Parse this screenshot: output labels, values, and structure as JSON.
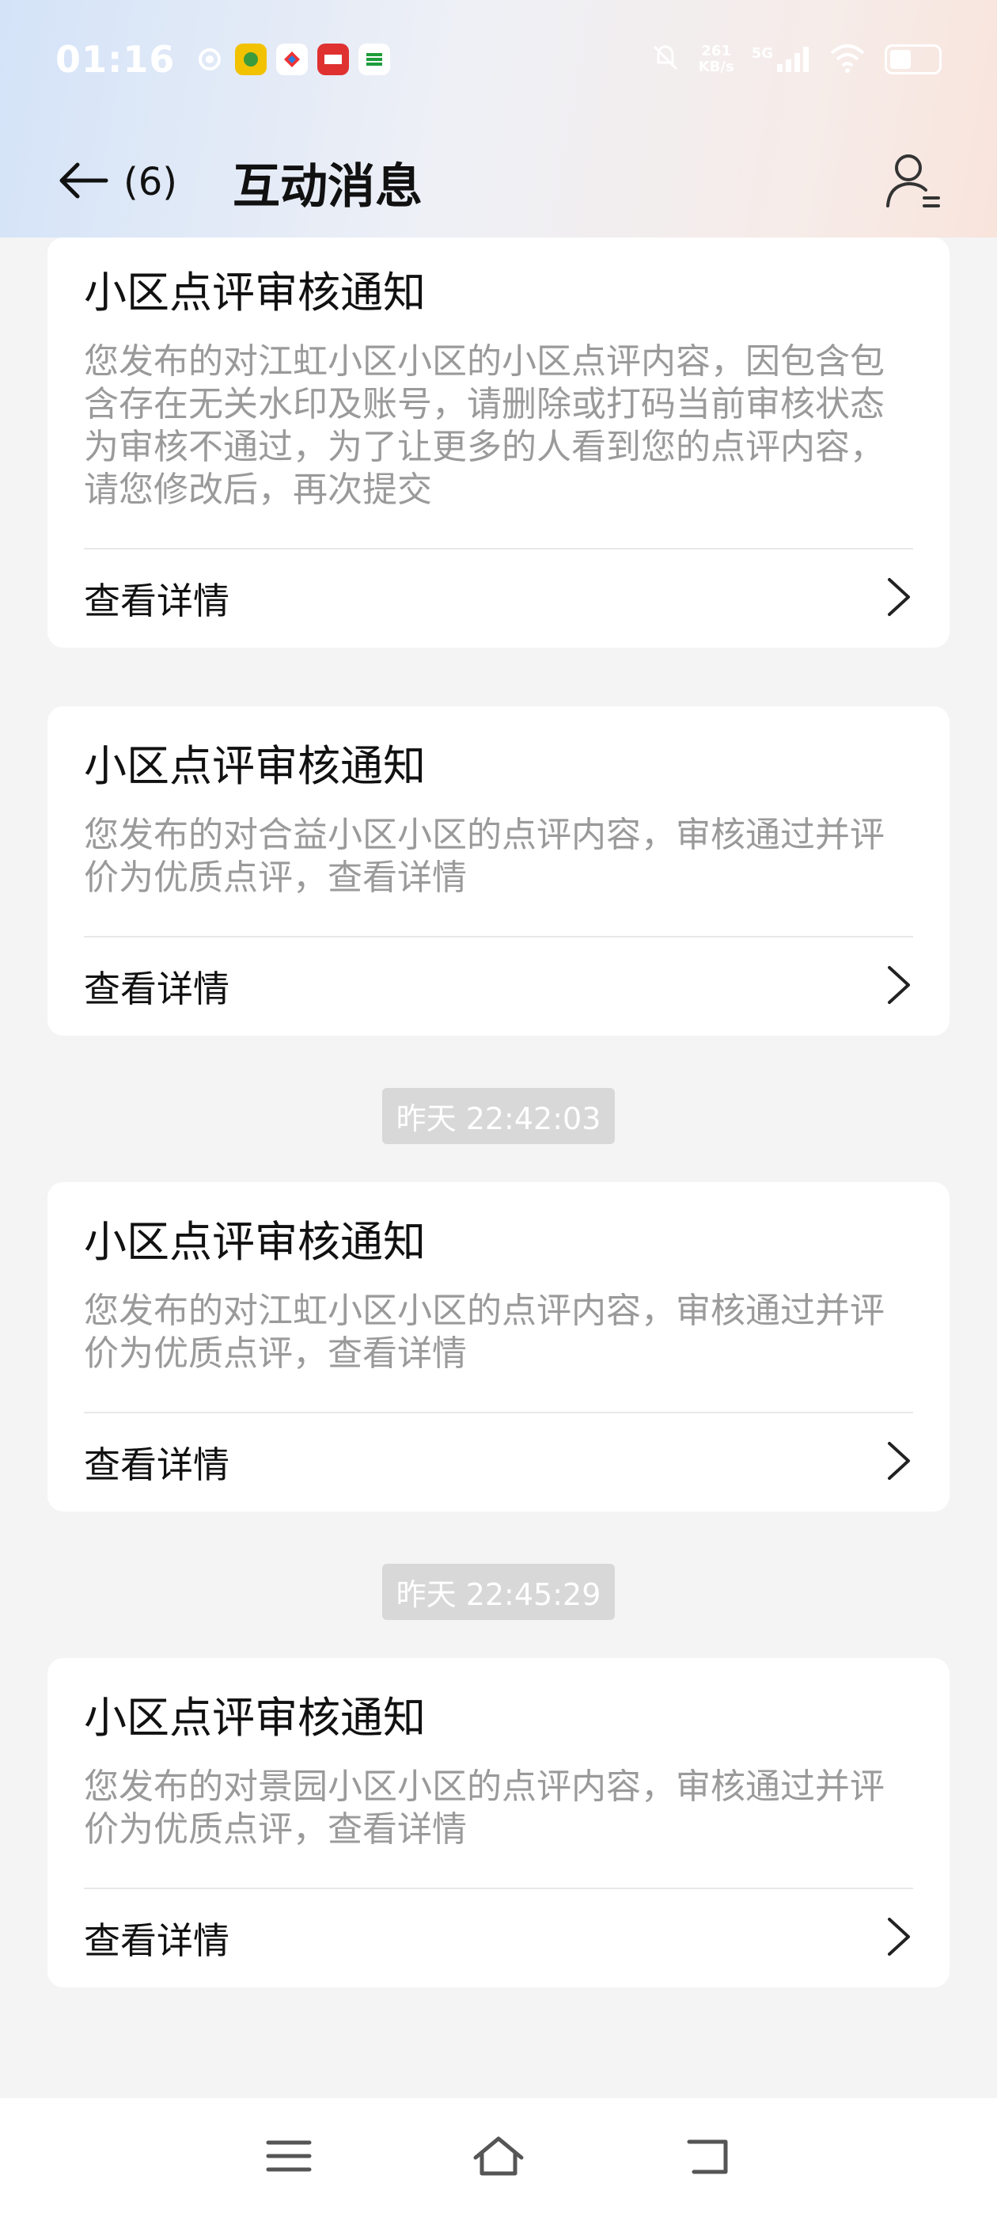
{
  "status_bar": {
    "time": "01:16",
    "net_speed_value": "261",
    "net_speed_unit": "KB/s",
    "signal_label": "5G"
  },
  "header": {
    "back_count": "(6)",
    "title": "互动消息"
  },
  "cards": [
    {
      "title": "小区点评审核通知",
      "body": "您发布的对江虹小区小区的小区点评内容，因包含包含存在无关水印及账号，请删除或打码当前审核状态为审核不通过，为了让更多的人看到您的点评内容，请您修改后，再次提交",
      "link_label": "查看详情"
    },
    {
      "title": "小区点评审核通知",
      "body": "您发布的对合益小区小区的点评内容，审核通过并评价为优质点评，查看详情",
      "link_label": "查看详情"
    },
    {
      "timestamp": "昨天 22:42:03",
      "title": "小区点评审核通知",
      "body": "您发布的对江虹小区小区的点评内容，审核通过并评价为优质点评，查看详情",
      "link_label": "查看详情"
    },
    {
      "timestamp": "昨天 22:45:29",
      "title": "小区点评审核通知",
      "body": "您发布的对景园小区小区的点评内容，审核通过并评价为优质点评，查看详情",
      "link_label": "查看详情"
    }
  ],
  "icons": {
    "back": "arrow-left-icon",
    "profile": "user-settings-icon",
    "chevron": "chevron-right-icon",
    "nav_menu": "menu-icon",
    "nav_home": "home-icon",
    "nav_back": "back-icon"
  },
  "colors": {
    "title_text": "#111111",
    "body_text": "#9a9a9a",
    "timestamp_bg": "#d8d8d8",
    "page_bg": "#f4f4f5"
  }
}
